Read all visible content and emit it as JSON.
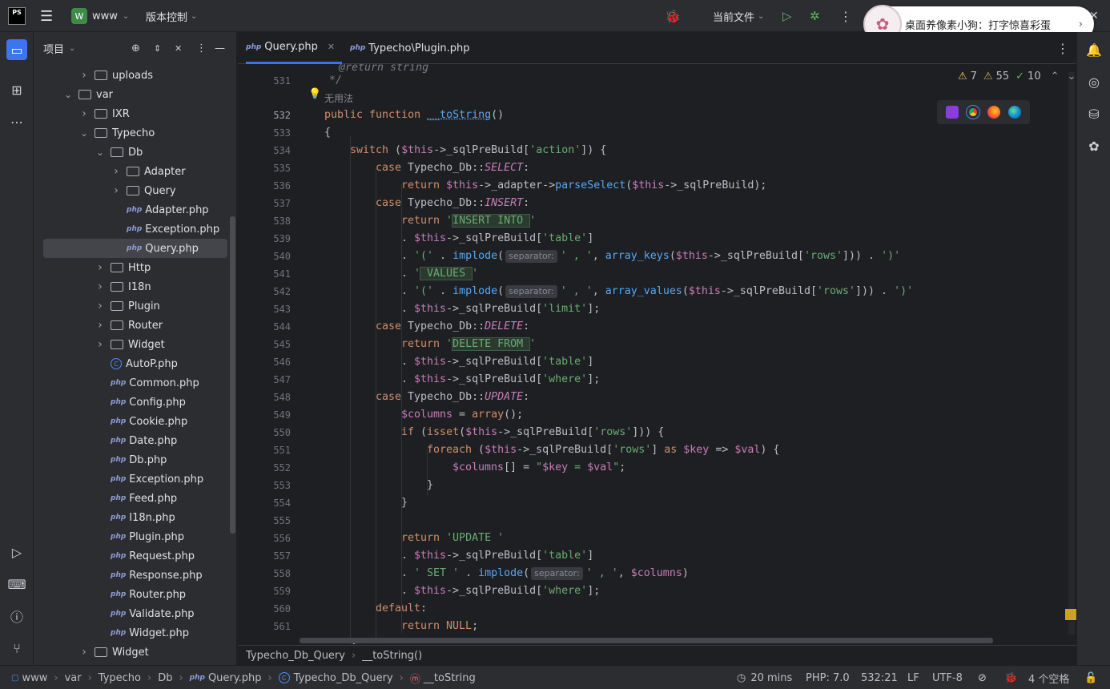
{
  "titlebar": {
    "logo": "PS",
    "project_badge": "W",
    "project_name": "www",
    "vcs_menu": "版本控制",
    "run_config": "当前文件"
  },
  "toast": {
    "text": "桌面养像素小狗：打字惊喜彩蛋"
  },
  "project_panel": {
    "title": "项目",
    "tree": [
      {
        "label": "uploads",
        "type": "folder",
        "depth": 2,
        "expanded": false
      },
      {
        "label": "var",
        "type": "folder",
        "depth": 1,
        "expanded": true
      },
      {
        "label": "IXR",
        "type": "folder",
        "depth": 2,
        "expanded": false
      },
      {
        "label": "Typecho",
        "type": "folder",
        "depth": 2,
        "expanded": true
      },
      {
        "label": "Db",
        "type": "folder",
        "depth": 3,
        "expanded": true
      },
      {
        "label": "Adapter",
        "type": "folder",
        "depth": 4,
        "expanded": false
      },
      {
        "label": "Query",
        "type": "folder",
        "depth": 4,
        "expanded": false
      },
      {
        "label": "Adapter.php",
        "type": "php",
        "depth": 4
      },
      {
        "label": "Exception.php",
        "type": "php",
        "depth": 4
      },
      {
        "label": "Query.php",
        "type": "php",
        "depth": 4,
        "selected": true
      },
      {
        "label": "Http",
        "type": "folder",
        "depth": 3,
        "expanded": false
      },
      {
        "label": "I18n",
        "type": "folder",
        "depth": 3,
        "expanded": false
      },
      {
        "label": "Plugin",
        "type": "folder",
        "depth": 3,
        "expanded": false
      },
      {
        "label": "Router",
        "type": "folder",
        "depth": 3,
        "expanded": false
      },
      {
        "label": "Widget",
        "type": "folder",
        "depth": 3,
        "expanded": false
      },
      {
        "label": "AutoP.php",
        "type": "class",
        "depth": 3
      },
      {
        "label": "Common.php",
        "type": "php",
        "depth": 3
      },
      {
        "label": "Config.php",
        "type": "php",
        "depth": 3
      },
      {
        "label": "Cookie.php",
        "type": "php",
        "depth": 3
      },
      {
        "label": "Date.php",
        "type": "php",
        "depth": 3
      },
      {
        "label": "Db.php",
        "type": "php",
        "depth": 3
      },
      {
        "label": "Exception.php",
        "type": "php",
        "depth": 3
      },
      {
        "label": "Feed.php",
        "type": "php",
        "depth": 3
      },
      {
        "label": "I18n.php",
        "type": "php",
        "depth": 3
      },
      {
        "label": "Plugin.php",
        "type": "php",
        "depth": 3
      },
      {
        "label": "Request.php",
        "type": "php",
        "depth": 3
      },
      {
        "label": "Response.php",
        "type": "php",
        "depth": 3
      },
      {
        "label": "Router.php",
        "type": "php",
        "depth": 3
      },
      {
        "label": "Validate.php",
        "type": "php",
        "depth": 3
      },
      {
        "label": "Widget.php",
        "type": "php",
        "depth": 3
      },
      {
        "label": "Widget",
        "type": "folder",
        "depth": 2,
        "expanded": false
      }
    ]
  },
  "tabs": [
    {
      "icon": "php",
      "label": "Query.php",
      "active": true,
      "closable": true
    },
    {
      "icon": "php",
      "label": "Typecho\\Plugin.php",
      "active": false
    }
  ],
  "inspections": {
    "warnings": "7",
    "weak_warnings": "55",
    "typos": "10"
  },
  "editor": {
    "usage_hint": "无用法",
    "lines": [
      "531",
      "532",
      "533",
      "534",
      "535",
      "536",
      "537",
      "538",
      "539",
      "540",
      "541",
      "542",
      "543",
      "544",
      "545",
      "546",
      "547",
      "548",
      "549",
      "550",
      "551",
      "552",
      "553",
      "554",
      "555",
      "556",
      "557",
      "558",
      "559",
      "560",
      "561"
    ],
    "param_hint": "separator:"
  },
  "breadcrumb_bar": {
    "class": "Typecho_Db_Query",
    "method": "__toString()"
  },
  "statusbar": {
    "path": [
      "www",
      "var",
      "Typecho",
      "Db",
      "Query.php",
      "Typecho_Db_Query",
      "__toString"
    ],
    "time": "20 mins",
    "php": "PHP: 7.0",
    "position": "532:21",
    "line_sep": "LF",
    "encoding": "UTF-8",
    "indent": "4 个空格"
  }
}
